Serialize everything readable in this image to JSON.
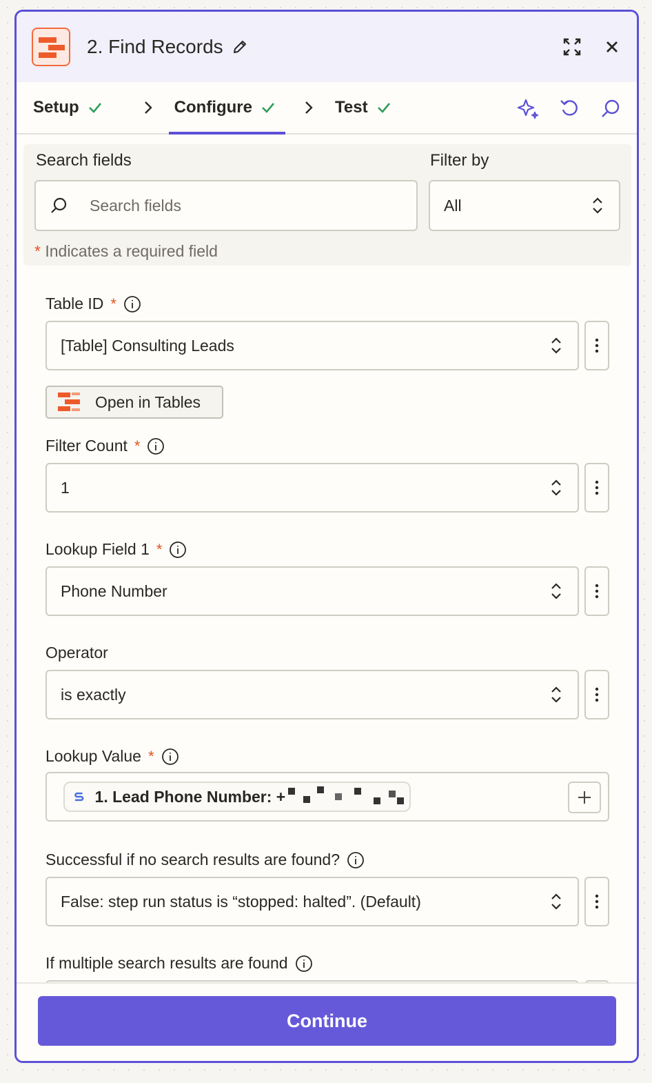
{
  "header": {
    "title": "2. Find Records"
  },
  "steps": [
    {
      "label": "Setup"
    },
    {
      "label": "Configure"
    },
    {
      "label": "Test"
    }
  ],
  "search": {
    "label": "Search fields",
    "placeholder": "Search fields"
  },
  "filter": {
    "label": "Filter by",
    "value": "All"
  },
  "required_note": {
    "star": "*",
    "text": "Indicates a required field"
  },
  "fields": {
    "table_id": {
      "label": "Table ID",
      "value": "[Table] Consulting Leads"
    },
    "open_in_tables": {
      "label": "Open in Tables"
    },
    "filter_count": {
      "label": "Filter Count",
      "value": "1"
    },
    "lookup_field": {
      "label": "Lookup Field 1",
      "value": "Phone Number"
    },
    "operator": {
      "label": "Operator",
      "value": "is exactly"
    },
    "lookup_value": {
      "label": "Lookup Value",
      "pill_text": "1. Lead Phone Number: +"
    },
    "success_if_none": {
      "label": "Successful if no search results are found?",
      "value": "False: step run status is “stopped: halted”. (Default)"
    },
    "multiple_results": {
      "label": "If multiple search results are found"
    }
  },
  "footer": {
    "continue_label": "Continue"
  },
  "colors": {
    "accent": "#5b50d6",
    "button": "#6659d9",
    "required": "#e2541f",
    "check": "#2e9c5a",
    "brand": "#ee5b2a"
  },
  "icons": [
    "tables-logo-icon",
    "pencil-icon",
    "expand-icon",
    "close-icon",
    "check-icon",
    "chevron-right-icon",
    "sparkle-icon",
    "undo-icon",
    "search-icon",
    "chevron-updown-icon",
    "info-icon",
    "kebab-icon",
    "plus-icon"
  ]
}
